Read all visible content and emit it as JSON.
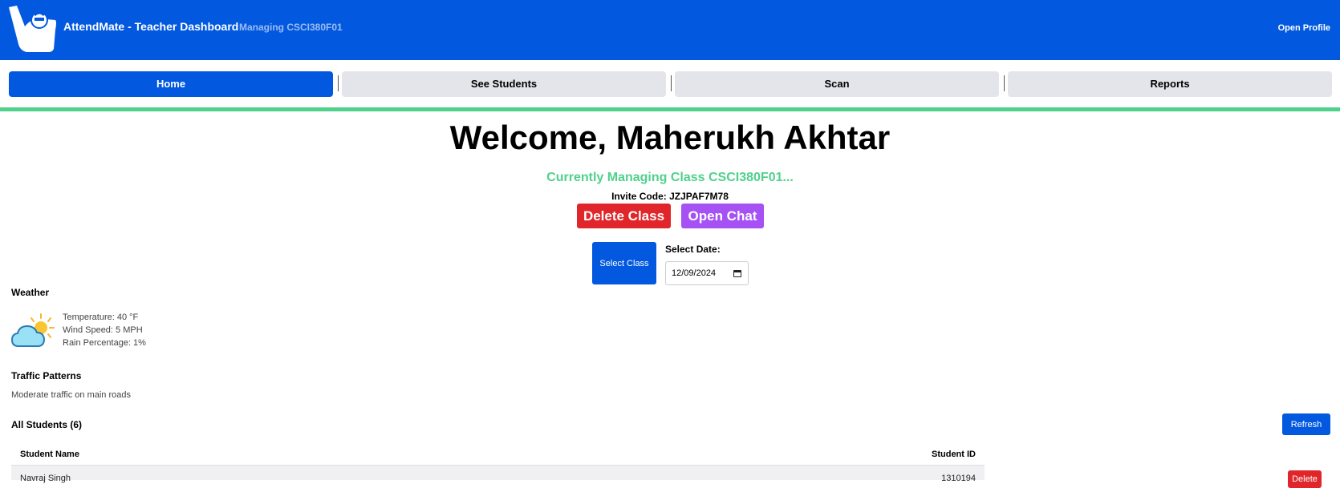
{
  "header": {
    "title": "AttendMate - Teacher Dashboard",
    "subtitle": "Managing CSCI380F01",
    "profile_label": "Open Profile",
    "brand_color": "#0259e0"
  },
  "nav": {
    "tabs": [
      {
        "label": "Home",
        "active": true
      },
      {
        "label": "See Students",
        "active": false
      },
      {
        "label": "Scan",
        "active": false
      },
      {
        "label": "Reports",
        "active": false
      }
    ]
  },
  "main": {
    "welcome": "Welcome, Maherukh Akhtar",
    "managing": "Currently Managing Class CSCI380F01...",
    "invite": "Invite Code: JZJPAF7M78",
    "delete_class_label": "Delete Class",
    "open_chat_label": "Open Chat",
    "select_class_label": "Select Class",
    "date_label": "Select Date:",
    "date_value": "12/09/2024"
  },
  "weather": {
    "title": "Weather",
    "icon": "partly-cloudy-icon",
    "temperature": "Temperature: 40 °F",
    "wind": "Wind Speed: 5 MPH",
    "rain": "Rain Percentage: 1%"
  },
  "traffic": {
    "title": "Traffic Patterns",
    "text": "Moderate traffic on main roads"
  },
  "students": {
    "title": "All Students (6)",
    "refresh_label": "Refresh",
    "columns": [
      "Student Name",
      "Student ID"
    ],
    "rows": [
      {
        "name": "Navraj Singh",
        "id": "1310194",
        "action": "Delete"
      }
    ]
  },
  "colors": {
    "accent_green": "#4fd18b",
    "danger": "#e0262b",
    "purple": "#a551f4",
    "tab_inactive": "#e4e5ea"
  }
}
